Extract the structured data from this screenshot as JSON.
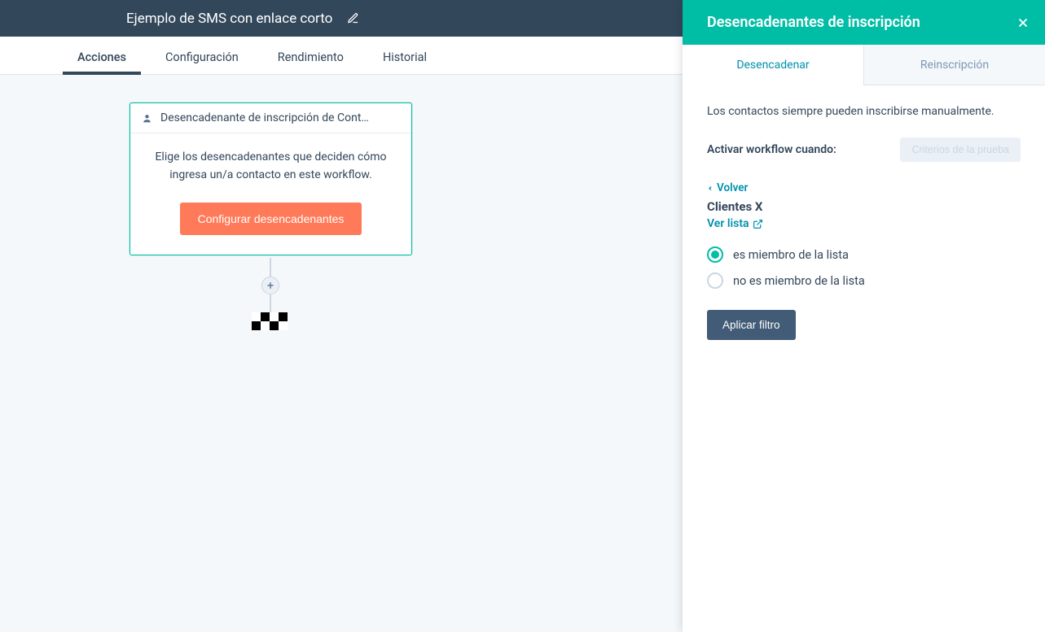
{
  "header": {
    "title": "Ejemplo de SMS con enlace corto"
  },
  "tabs": {
    "items": [
      "Acciones",
      "Configuración",
      "Rendimiento",
      "Historial"
    ],
    "activeIndex": 0
  },
  "card": {
    "header": "Desencadenante de inscripción de Cont…",
    "text": "Elige los desencadenantes que deciden cómo ingresa un/a contacto en este workflow.",
    "button": "Configurar desencadenantes"
  },
  "addStep": "+",
  "panel": {
    "title": "Desencadenantes de inscripción",
    "tabs": [
      "Desencadenar",
      "Reinscripción"
    ],
    "activeTab": 0,
    "intro": "Los contactos siempre pueden inscribirse manualmente.",
    "activateLabel": "Activar workflow cuando:",
    "testButton": "Criterios de la prueba",
    "back": "Volver",
    "listName": "Clientes X",
    "viewList": "Ver lista",
    "options": [
      {
        "label": "es miembro de la lista",
        "selected": true
      },
      {
        "label": "no es miembro de la lista",
        "selected": false
      }
    ],
    "apply": "Aplicar filtro"
  }
}
